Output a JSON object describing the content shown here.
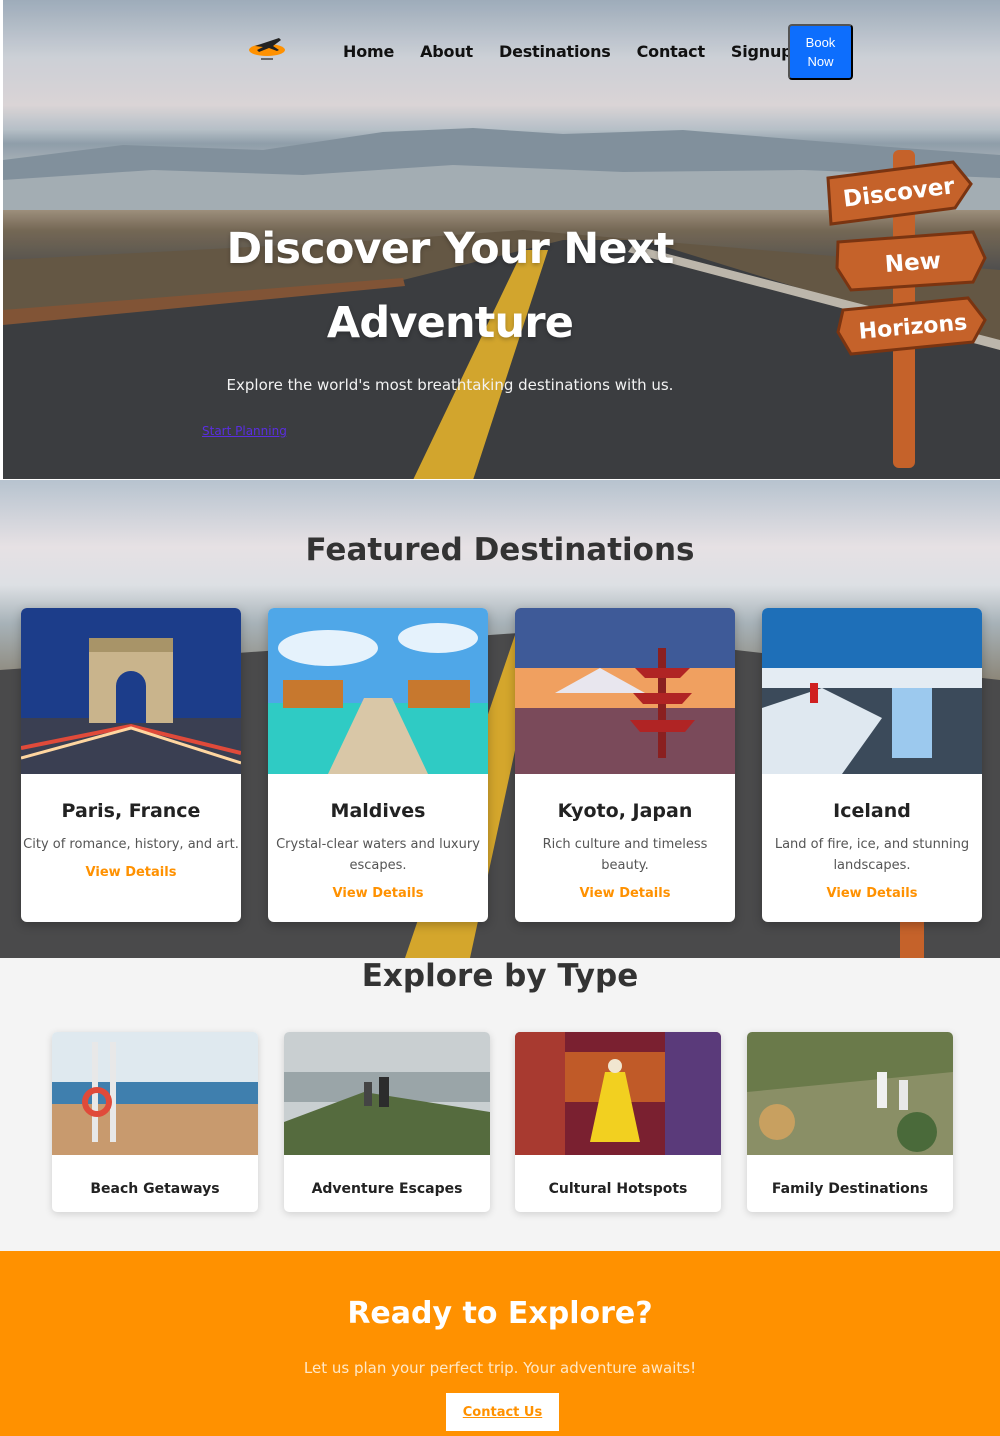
{
  "nav": {
    "links": [
      "Home",
      "About",
      "Destinations",
      "Contact",
      "Signup"
    ],
    "book_button": "Book Now"
  },
  "hero": {
    "title": "Discover Your Next Adventure",
    "subtitle": "Explore the world's most breathtaking destinations with us.",
    "link": "Start Planning",
    "sign": [
      "Discover",
      "New",
      "Horizons"
    ]
  },
  "featured": {
    "title": "Featured Destinations",
    "cards": [
      {
        "name": "Paris, France",
        "desc": "City of romance, history, and art.",
        "link": "View Details",
        "image": "arc-de-triomphe-icon"
      },
      {
        "name": "Maldives",
        "desc": "Crystal-clear waters and luxury escapes.",
        "link": "View Details",
        "image": "overwater-bungalows-icon"
      },
      {
        "name": "Kyoto, Japan",
        "desc": "Rich culture and timeless beauty.",
        "link": "View Details",
        "image": "pagoda-icon"
      },
      {
        "name": "Iceland",
        "desc": "Land of fire, ice, and stunning landscapes.",
        "link": "View Details",
        "image": "waterfall-icon"
      }
    ]
  },
  "explore": {
    "title": "Explore by Type",
    "types": [
      {
        "name": "Beach Getaways",
        "image": "beach-icon"
      },
      {
        "name": "Adventure Escapes",
        "image": "hikers-icon"
      },
      {
        "name": "Cultural Hotspots",
        "image": "market-icon"
      },
      {
        "name": "Family Destinations",
        "image": "family-icon"
      }
    ]
  },
  "cta": {
    "title": "Ready to Explore?",
    "subtitle": "Let us plan your perfect trip. Your adventure awaits!",
    "button": "Contact Us"
  },
  "colors": {
    "accent": "#ff9100",
    "primary_button": "#0d6efd",
    "page_background": "#f4f4f4"
  }
}
